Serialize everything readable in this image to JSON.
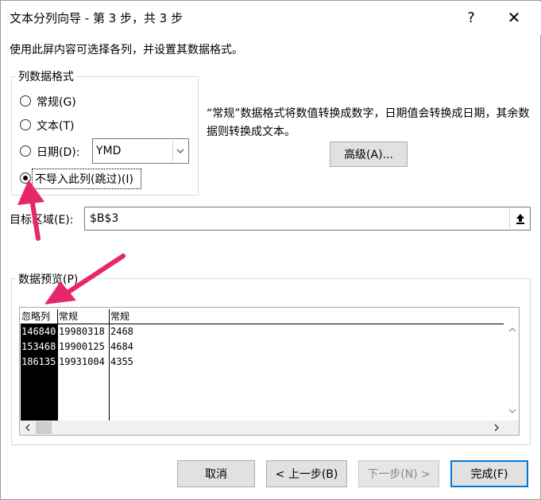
{
  "window": {
    "title": "文本分列向导 - 第 3 步，共 3 步",
    "help_glyph": "?",
    "close_glyph": "✕"
  },
  "description": "使用此屏内容可选择各列，并设置其数据格式。",
  "column_format": {
    "label": "列数据格式",
    "options": [
      {
        "label": "常规(G)",
        "checked": false
      },
      {
        "label": "文本(T)",
        "checked": false
      },
      {
        "label": "日期(D):",
        "checked": false
      },
      {
        "label": "不导入此列(跳过)(I)",
        "checked": true
      }
    ],
    "date_format": "YMD"
  },
  "info_text": "“常规”数据格式将数值转换成数字，日期值会转换成日期，其余数据则转换成文本。",
  "advanced_button": "高级(A)...",
  "target": {
    "label": "目标区域(E):",
    "value": "$B$3"
  },
  "preview": {
    "label": "数据预览(P)",
    "headers": [
      "忽略列",
      "常规",
      "常规"
    ],
    "rows": [
      [
        "146840",
        "19980318",
        "2468"
      ],
      [
        "153468",
        "19900125",
        "4684"
      ],
      [
        "186135",
        "19931004",
        "4355"
      ]
    ]
  },
  "buttons": {
    "cancel": "取消",
    "back": "< 上一步(B)",
    "next": "下一步(N) >",
    "finish": "完成(F)"
  },
  "colors": {
    "annotation_arrow": "#e8266b",
    "skipped_column_bg": "#000000",
    "button_bg": "#e1e1e1",
    "finish_border": "#0078d7"
  }
}
